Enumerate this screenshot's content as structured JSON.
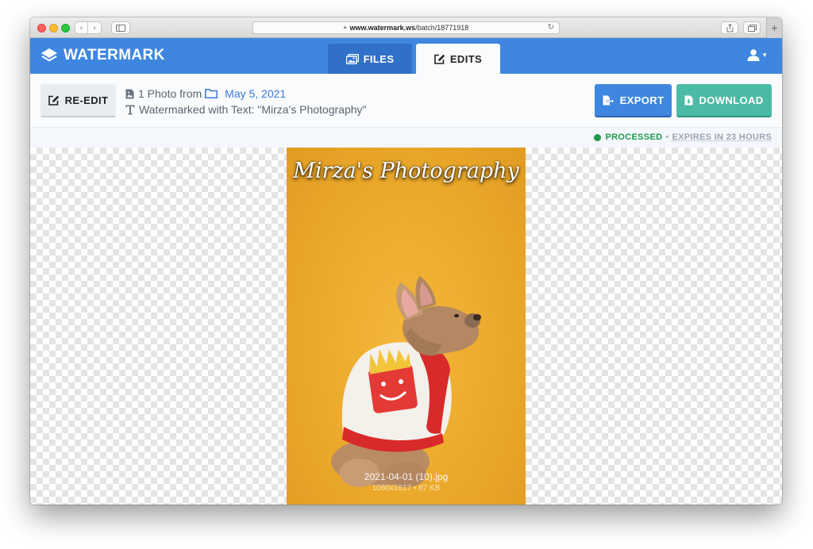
{
  "browser": {
    "url_host": "www.watermark.ws",
    "url_path": "/batch/18771918",
    "new_tab_label": "+"
  },
  "app": {
    "brand": "WATERMARK",
    "tabs": [
      {
        "label": "FILES",
        "icon": "images-icon",
        "active": false
      },
      {
        "label": "EDITS",
        "icon": "edit-icon",
        "active": true
      }
    ]
  },
  "toolbar": {
    "reedit_label": "RE-EDIT",
    "export_label": "EXPORT",
    "download_label": "DOWNLOAD"
  },
  "info": {
    "photo_count_text": "1 Photo from",
    "date_link": "May 5, 2021",
    "watermark_text": "Watermarked with Text: \"Mirza's Photography\""
  },
  "status": {
    "processed": "PROCESSED",
    "separator": "•",
    "expires": "EXPIRES IN 23 HOURS"
  },
  "image": {
    "watermark_overlay": "Mirza's Photography",
    "filename": "2021-04-01 (10).jpg",
    "meta": "1080x1617 • 87 KB"
  },
  "colors": {
    "brand_blue": "#3e86e0",
    "download_green": "#4bbba5",
    "processed_green": "#1d9a4e"
  }
}
